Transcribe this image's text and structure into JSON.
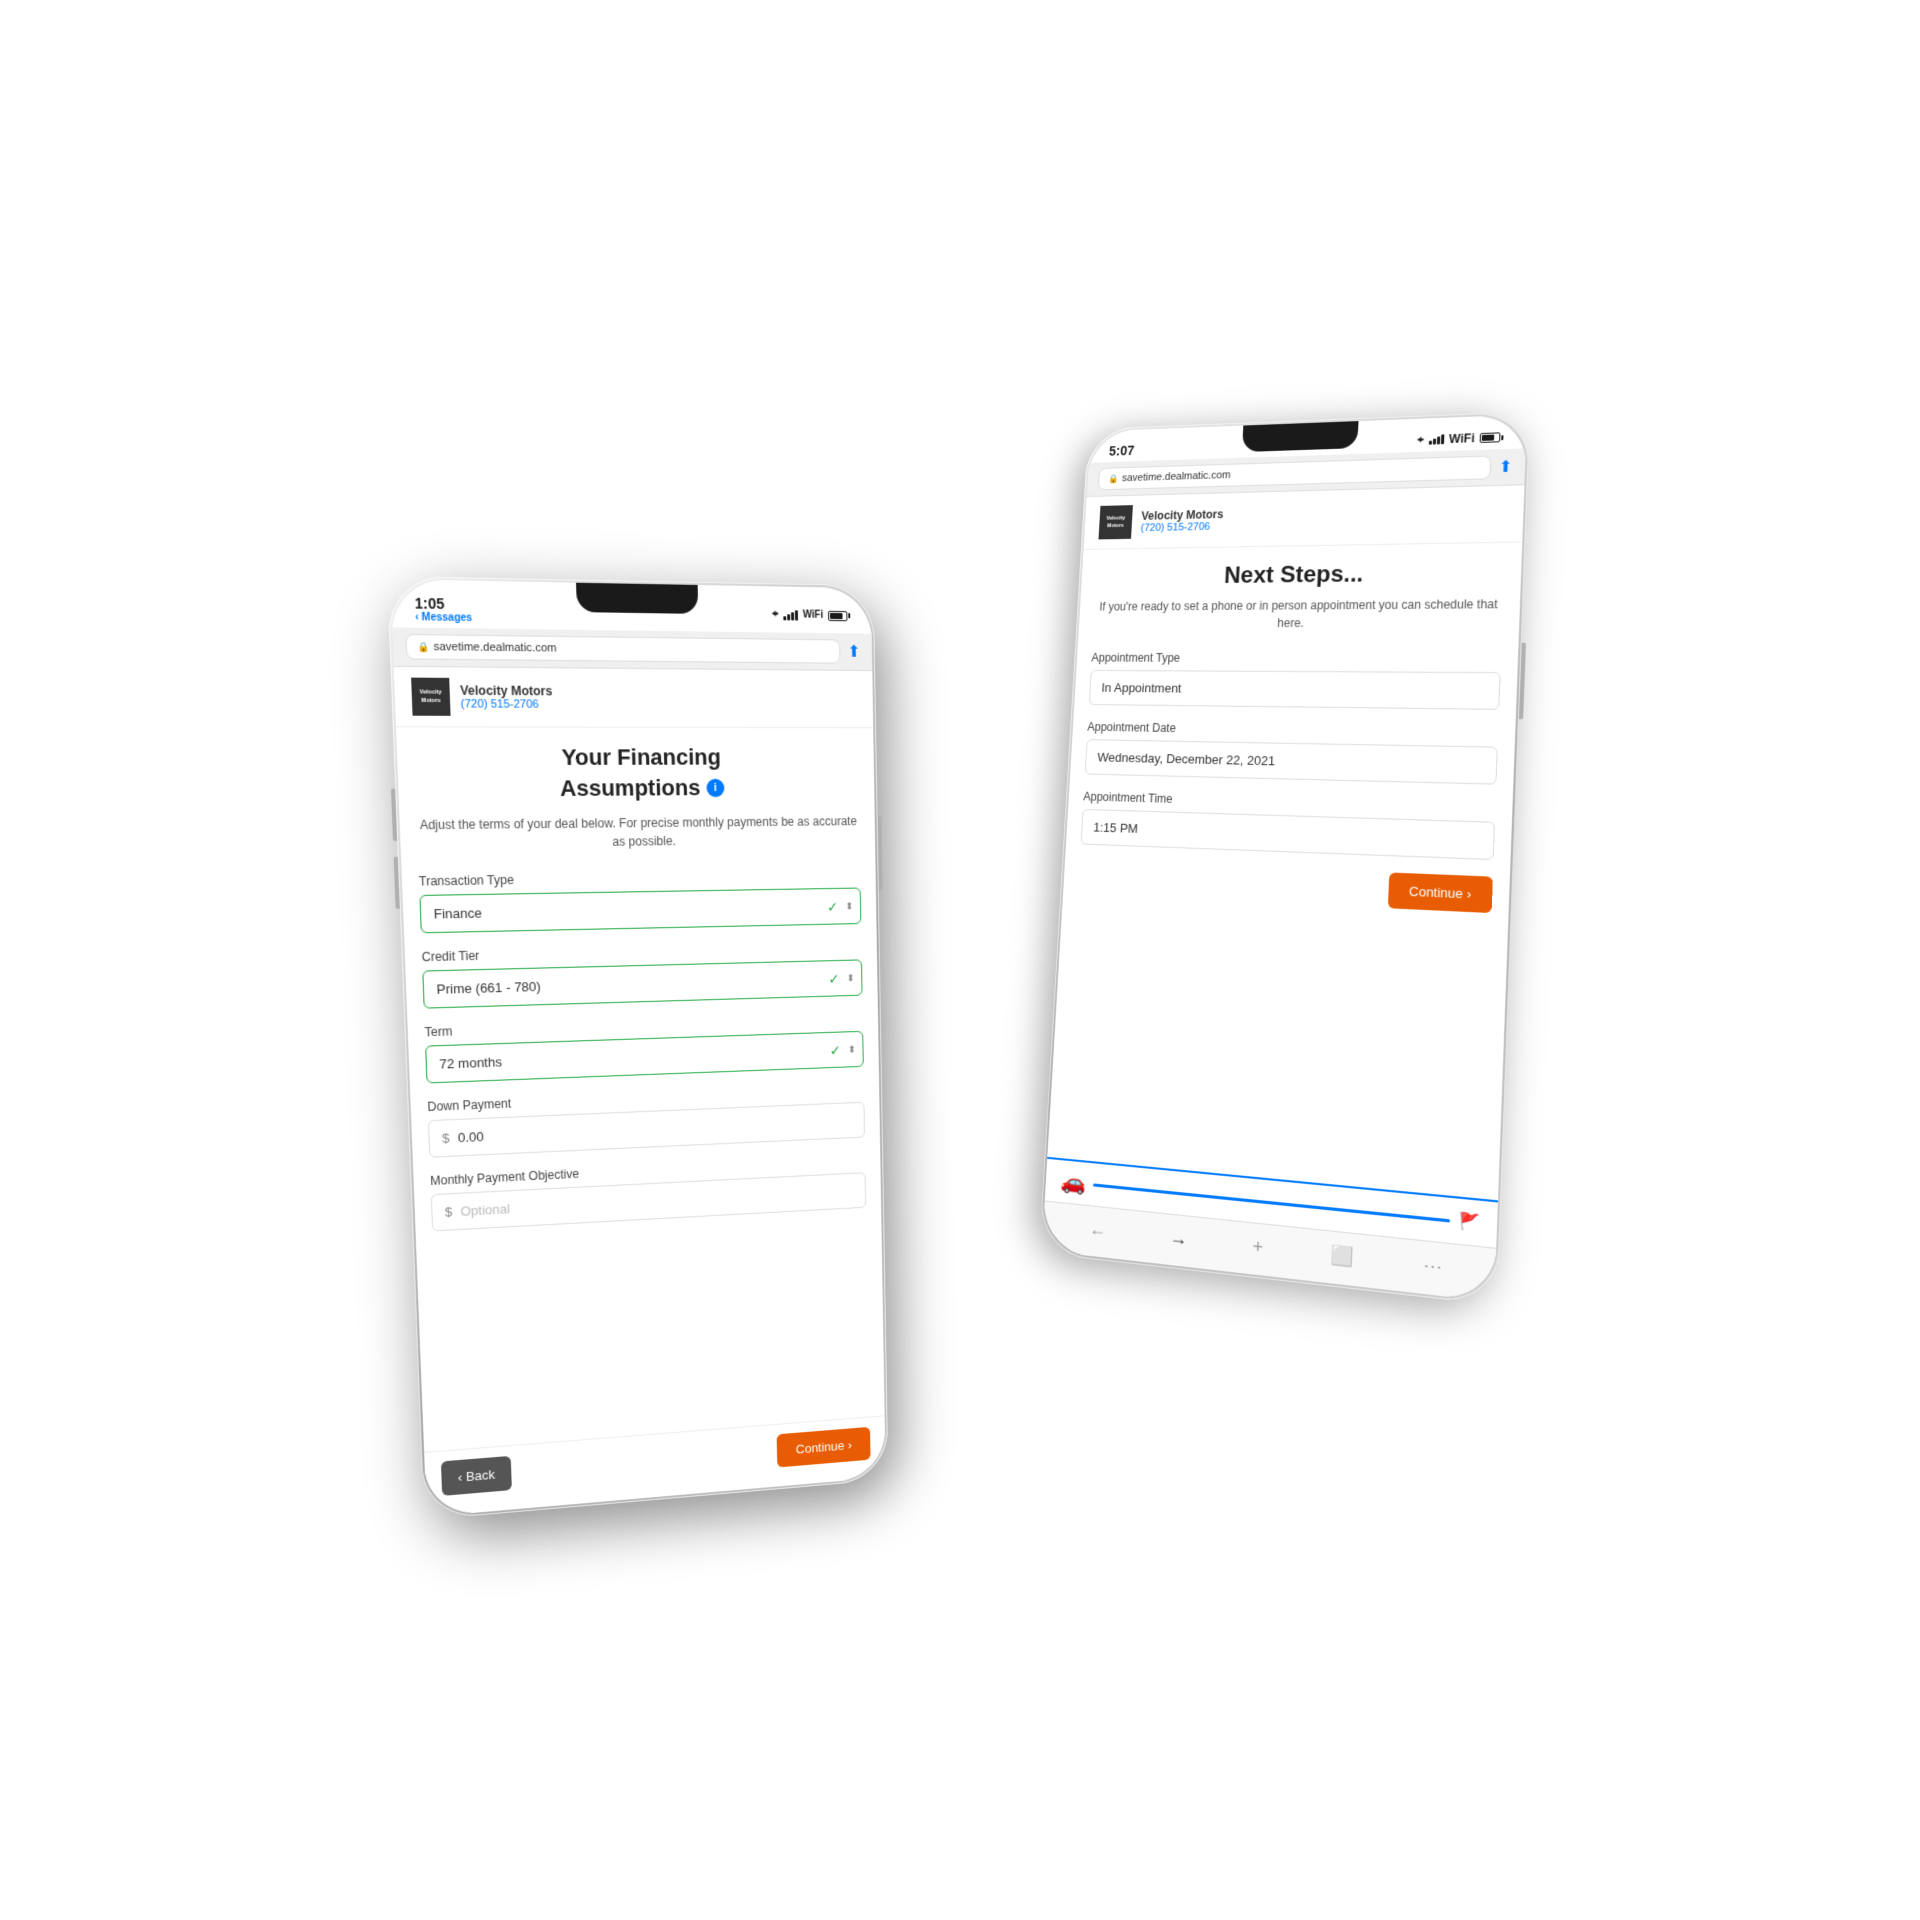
{
  "scene": {
    "background": "#ffffff"
  },
  "phone_back": {
    "status_bar": {
      "time": "5:07",
      "wifi": true,
      "battery": 75
    },
    "browser_url": "savetime.dealmatic.com",
    "dealer_name": "Velocity Motors",
    "dealer_phone": "(720) 515-2706",
    "page": {
      "title": "Next Steps...",
      "description": "If you're ready to set a phone or in person appointment you can schedule that here.",
      "appointment_type_label": "Appointment Type",
      "appointment_type_value": "In Appointment",
      "appointment_date_label": "Appointment Date",
      "appointment_date_value": "Wednesday, December 22, 2021",
      "appointment_time_label": "Appointment Time",
      "appointment_time_value": "1:15 PM",
      "continue_label": "Continue ›"
    }
  },
  "phone_front": {
    "status_bar": {
      "time": "1:05",
      "back_link": "‹ Messages",
      "wifi": true,
      "battery": 80
    },
    "browser_url": "savetime.dealmatic.com",
    "dealer_name": "Velocity Motors",
    "dealer_phone": "(720) 515-2706",
    "page": {
      "title_line1": "Your Financing",
      "title_line2": "Assumptions",
      "description": "Adjust the terms of your deal below. For precise monthly payments be as accurate as possible.",
      "transaction_type_label": "Transaction Type",
      "transaction_type_value": "Finance",
      "credit_tier_label": "Credit Tier",
      "credit_tier_value": "Prime (661 - 780)",
      "term_label": "Term",
      "term_value": "72 months",
      "down_payment_label": "Down Payment",
      "down_payment_prefix": "$",
      "down_payment_value": "0.00",
      "monthly_payment_label": "Monthly Payment Objective",
      "monthly_payment_prefix": "$",
      "monthly_payment_placeholder": "Optional",
      "back_label": "‹ Back",
      "continue_label": "Continue ›"
    }
  }
}
